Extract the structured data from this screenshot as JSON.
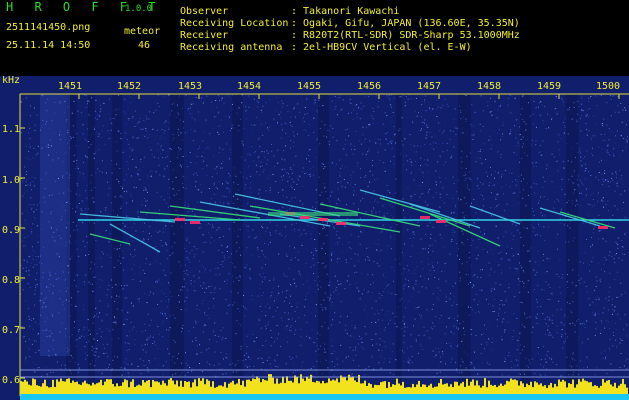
{
  "header": {
    "logo": "H R O F F T",
    "version": "1.0.0",
    "filename": "2511141450.png",
    "datetime": "25.11.14 14:50",
    "meteor_label": "meteor",
    "meteor_count": "46",
    "info_labels": [
      "Observer",
      "Receiving Location",
      "Receiver",
      "Receiving antenna"
    ],
    "info_values": [
      ": Takanori Kawachi",
      ": Ogaki, Gifu, JAPAN (136.60E, 35.35N)",
      ": R820T2(RTL-SDR) SDR-Sharp 53.1000MHz",
      ": 2el-HB9CV Vertical (el. E-W)"
    ]
  },
  "spectrogram": {
    "y_unit": "kHz",
    "time_ticks": [
      "1451",
      "1452",
      "1453",
      "1454",
      "1455",
      "1456",
      "1457",
      "1458",
      "1459",
      "1500"
    ],
    "freq_ticks": [
      "1.1",
      "1.0",
      "0.9",
      "0.8",
      "0.7",
      "0.6"
    ],
    "freq_values": [
      1.1,
      1.0,
      0.9,
      0.8,
      0.7,
      0.6
    ],
    "colors": {
      "background": "#101e6c",
      "noise": "#3a5bd6",
      "carrier": "#2fd3e6",
      "echo_hot": "#ff2a6a",
      "echo_warm": "#37e07a",
      "level_bar": "#f2e21e",
      "base": "#19c7f2"
    }
  }
}
